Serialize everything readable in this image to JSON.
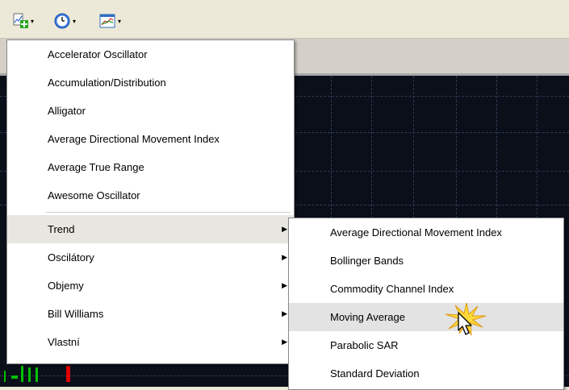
{
  "toolbar": {
    "buttons": [
      {
        "icon": "add-indicator-icon",
        "arrow": "▾"
      },
      {
        "icon": "clock-icon",
        "arrow": "▾"
      },
      {
        "icon": "chart-templates-icon",
        "arrow": "▾"
      }
    ]
  },
  "colors": {
    "chart_bg": "#0b0f1a",
    "grid": "#2c3a52",
    "bull_candle": "#00c000",
    "bear_candle": "#e00000",
    "highlight": "#e7e6e1"
  },
  "indicators_menu": {
    "items": [
      {
        "label": "Accelerator Oscillator"
      },
      {
        "label": "Accumulation/Distribution"
      },
      {
        "label": "Alligator"
      },
      {
        "label": "Average Directional Movement Index"
      },
      {
        "label": "Average True Range"
      },
      {
        "label": "Awesome Oscillator"
      }
    ],
    "groups": [
      {
        "label": "Trend",
        "arrow": "▶"
      },
      {
        "label": "Oscilátory",
        "arrow": "▶"
      },
      {
        "label": "Objemy",
        "arrow": "▶"
      },
      {
        "label": "Bill Williams",
        "arrow": "▶"
      },
      {
        "label": "Vlastní",
        "arrow": "▶"
      }
    ]
  },
  "trend_submenu": {
    "items": [
      {
        "label": "Average Directional Movement Index"
      },
      {
        "label": "Bollinger Bands"
      },
      {
        "label": "Commodity Channel Index"
      },
      {
        "label": "Moving Average"
      },
      {
        "label": "Parabolic SAR"
      },
      {
        "label": "Standard Deviation"
      }
    ]
  }
}
